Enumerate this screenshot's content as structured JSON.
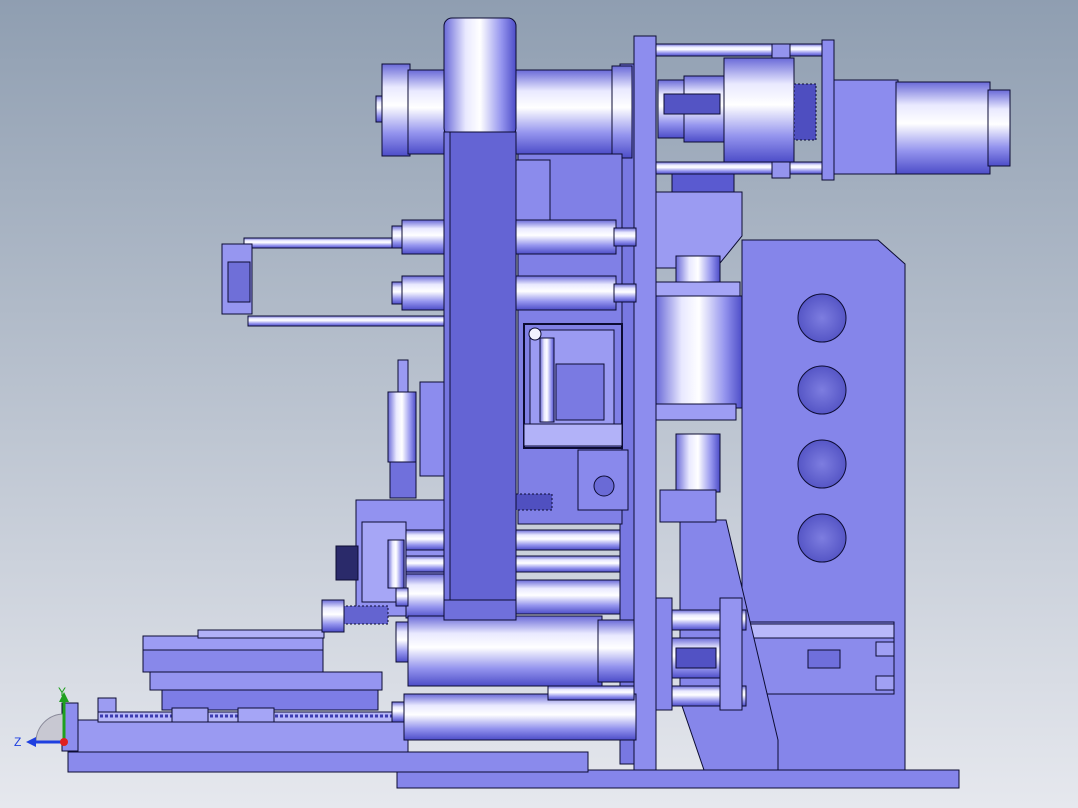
{
  "viewport": {
    "background_top": "#8f9eb1",
    "background_bottom": "#e6e8ee"
  },
  "colors": {
    "body": "#8585ea",
    "body_light": "#b7b7f8",
    "body_dark": "#5a5ad0",
    "highlight": "#f2f2ff",
    "edge": "#0c0c33",
    "hole": "#6d6dd6",
    "belt": "#6464d4",
    "axis_y": "#1fa01f",
    "axis_z": "#1f3fe0",
    "origin": "#e01f1f"
  },
  "triad": {
    "y_label": "Y",
    "z_label": "Z"
  }
}
